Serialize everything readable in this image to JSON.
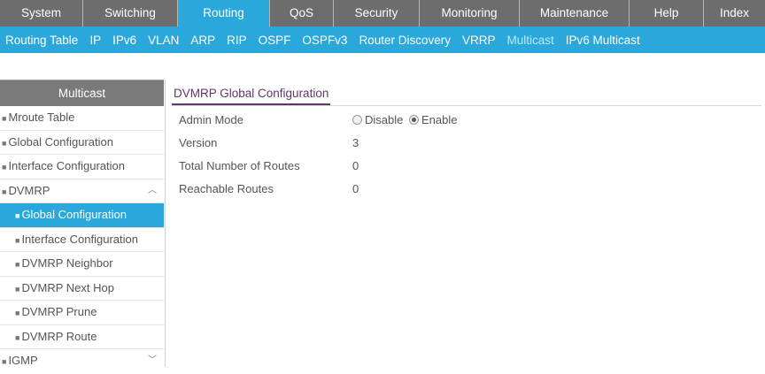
{
  "topnav": {
    "tabs": [
      "System",
      "Switching",
      "Routing",
      "QoS",
      "Security",
      "Monitoring",
      "Maintenance",
      "Help",
      "Index"
    ]
  },
  "subnav": {
    "items": [
      "Routing Table",
      "IP",
      "IPv6",
      "VLAN",
      "ARP",
      "RIP",
      "OSPF",
      "OSPFv3",
      "Router Discovery",
      "VRRP",
      "Multicast",
      "IPv6 Multicast"
    ]
  },
  "sidebar": {
    "header": "Multicast",
    "items": [
      "Mroute Table",
      "Global Configuration",
      "Interface Configuration",
      "DVMRP",
      "Global Configuration",
      "Interface Configuration",
      "DVMRP Neighbor",
      "DVMRP Next Hop",
      "DVMRP Prune",
      "DVMRP Route",
      "IGMP"
    ]
  },
  "main": {
    "title": "DVMRP Global Configuration",
    "admin_mode": {
      "label": "Admin Mode",
      "options": [
        "Disable",
        "Enable"
      ],
      "selected": "Enable"
    },
    "version": {
      "label": "Version",
      "value": "3"
    },
    "total_routes": {
      "label": "Total Number of Routes",
      "value": "0"
    },
    "reachable_routes": {
      "label": "Reachable Routes",
      "value": "0"
    }
  },
  "colors": {
    "accent": "#2aa8dc",
    "topnav": "#6d6d6d",
    "sidebar_header": "#7a7a7a",
    "title": "#62366c"
  }
}
